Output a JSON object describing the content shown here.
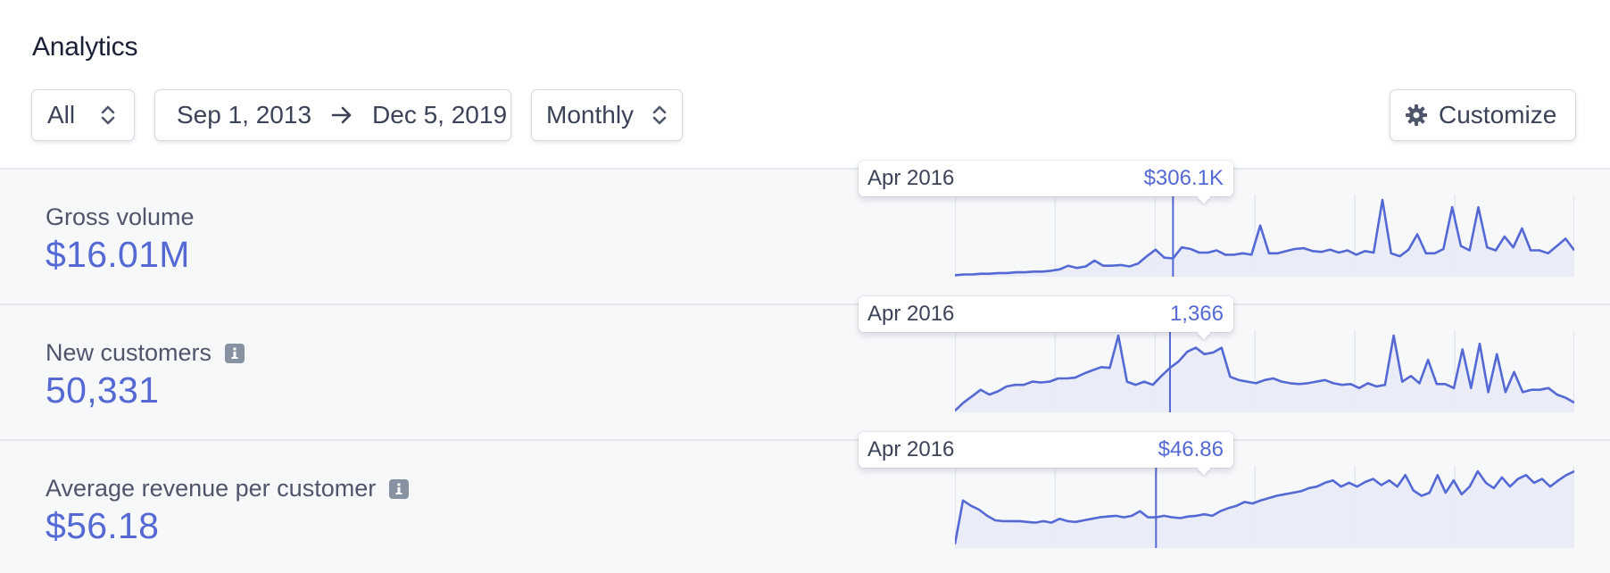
{
  "header": {
    "title": "Analytics"
  },
  "filters": {
    "scope": {
      "selected": "All"
    },
    "date_range": {
      "start": "Sep 1, 2013",
      "end": "Dec 5, 2019"
    },
    "interval": {
      "selected": "Monthly"
    },
    "customize_label": "Customize"
  },
  "colors": {
    "accent": "#5469d4",
    "fill": "#e8eaf6",
    "row_bg": "#f7f8fa",
    "label": "#4f566b"
  },
  "metrics": [
    {
      "label": "Gross volume",
      "value": "$16.01M",
      "has_info_icon": false,
      "tooltip": {
        "period": "Apr 2016",
        "value": "$306.1K"
      }
    },
    {
      "label": "New customers",
      "value": "50,331",
      "has_info_icon": true,
      "tooltip": {
        "period": "Apr 2016",
        "value": "1,366"
      }
    },
    {
      "label": "Average revenue per customer",
      "value": "$56.18",
      "has_info_icon": true,
      "tooltip": {
        "period": "Apr 2016",
        "value": "$46.86"
      }
    }
  ],
  "chart_data": [
    {
      "type": "area",
      "highlight_index": 25,
      "values": [
        2,
        3,
        3,
        4,
        4,
        5,
        5,
        6,
        6,
        7,
        7,
        8,
        10,
        15,
        12,
        14,
        22,
        15,
        15,
        16,
        14,
        18,
        28,
        37,
        26,
        25,
        40,
        38,
        33,
        33,
        36,
        30,
        30,
        32,
        30,
        70,
        32,
        32,
        35,
        38,
        39,
        35,
        34,
        37,
        33,
        36,
        30,
        35,
        33,
        105,
        32,
        28,
        37,
        58,
        32,
        32,
        38,
        95,
        42,
        36,
        95,
        40,
        36,
        55,
        40,
        66,
        36,
        36,
        32,
        42,
        52,
        36
      ]
    },
    {
      "type": "area",
      "highlight_index": 25,
      "values": [
        2,
        12,
        20,
        28,
        22,
        26,
        32,
        34,
        34,
        38,
        37,
        38,
        42,
        42,
        43,
        48,
        52,
        56,
        55,
        95,
        38,
        34,
        38,
        34,
        45,
        55,
        63,
        75,
        80,
        72,
        74,
        80,
        44,
        40,
        38,
        36,
        40,
        42,
        38,
        36,
        35,
        36,
        38,
        40,
        36,
        34,
        35,
        30,
        36,
        32,
        34,
        95,
        38,
        45,
        36,
        65,
        35,
        35,
        30,
        78,
        30,
        85,
        25,
        72,
        25,
        50,
        25,
        28,
        28,
        30,
        22,
        18,
        12
      ]
    },
    {
      "type": "area",
      "highlight_index": 25,
      "values": [
        5,
        62,
        55,
        50,
        42,
        36,
        35,
        35,
        35,
        34,
        33,
        35,
        33,
        38,
        35,
        34,
        36,
        38,
        40,
        41,
        42,
        40,
        42,
        48,
        40,
        40,
        42,
        40,
        39,
        41,
        42,
        44,
        42,
        48,
        52,
        55,
        60,
        58,
        62,
        65,
        68,
        70,
        72,
        74,
        78,
        80,
        85,
        88,
        80,
        85,
        80,
        86,
        90,
        82,
        88,
        80,
        95,
        75,
        68,
        72,
        95,
        72,
        88,
        70,
        80,
        100,
        85,
        78,
        92,
        80,
        90,
        95,
        85,
        90,
        80,
        88,
        95,
        100
      ]
    }
  ]
}
